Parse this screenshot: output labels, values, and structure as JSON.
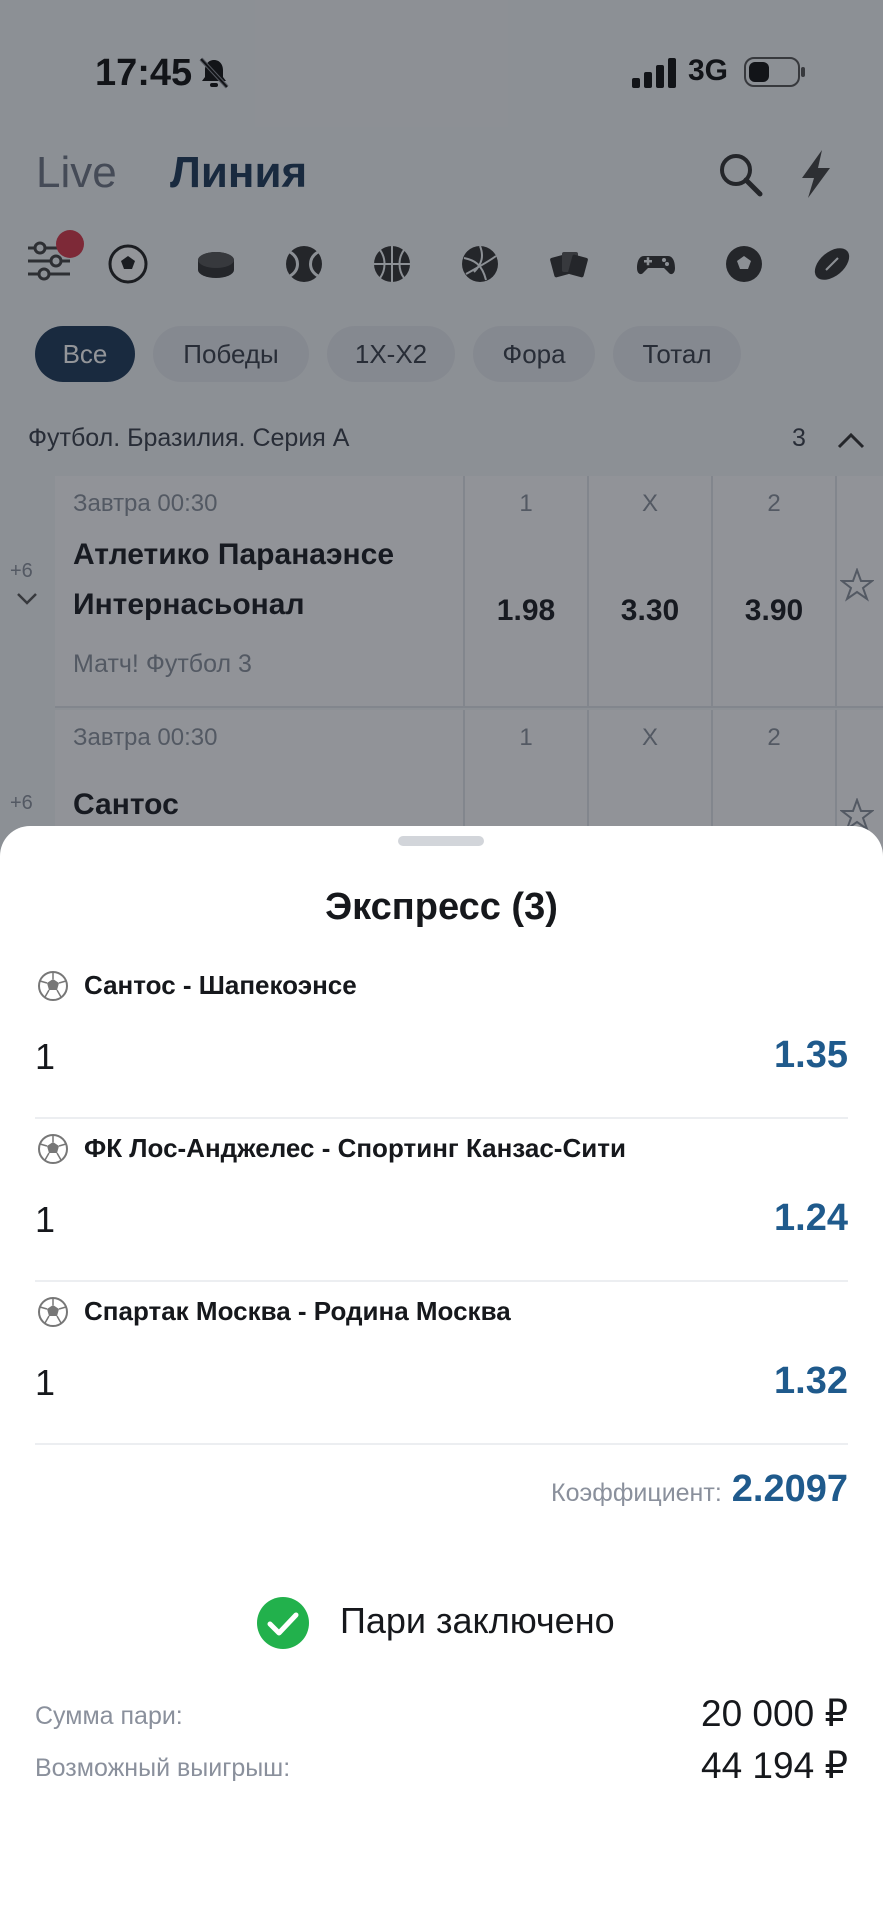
{
  "status_bar": {
    "time": "17:45",
    "network": "3G"
  },
  "nav": {
    "tab_live": "Live",
    "tab_line": "Линия"
  },
  "chips": [
    {
      "label": "Все",
      "active": true
    },
    {
      "label": "Победы"
    },
    {
      "label": "1X-X2"
    },
    {
      "label": "Фора"
    },
    {
      "label": "Тотал"
    }
  ],
  "league": {
    "name": "Футбол. Бразилия. Серия А",
    "count": "3"
  },
  "matches": [
    {
      "time": "Завтра 00:30",
      "team1": "Атлетико Паранаэнсе",
      "team2": "Интернасьонал",
      "broadcast": "Матч! Футбол 3",
      "more": "+6",
      "labels": [
        "1",
        "X",
        "2"
      ],
      "odds": [
        "1.98",
        "3.30",
        "3.90"
      ]
    },
    {
      "time": "Завтра 00:30",
      "team1": "Сантос",
      "more": "+6",
      "labels": [
        "1",
        "X",
        "2"
      ]
    }
  ],
  "sheet": {
    "title": "Экспресс (3)",
    "bets": [
      {
        "match": "Сантос - Шапекоэнсе",
        "outcome": "1",
        "coef": "1.35"
      },
      {
        "match": "ФК Лос-Анджелес - Спортинг Канзас-Сити",
        "outcome": "1",
        "coef": "1.24"
      },
      {
        "match": "Спартак Москва - Родина Москва",
        "outcome": "1",
        "coef": "1.32"
      }
    ],
    "total_label": "Коэффициент:",
    "total_value": "2.2097",
    "success_text": "Пари заключено",
    "stake_label": "Сумма пари:",
    "stake_value": "20 000 ₽",
    "win_label": "Возможный выигрыш:",
    "win_value": "44 194 ₽"
  },
  "colors": {
    "accent": "#1f5a8c",
    "primary_dark": "#1e3a5a",
    "success": "#22b14c",
    "badge": "#d7394a"
  }
}
